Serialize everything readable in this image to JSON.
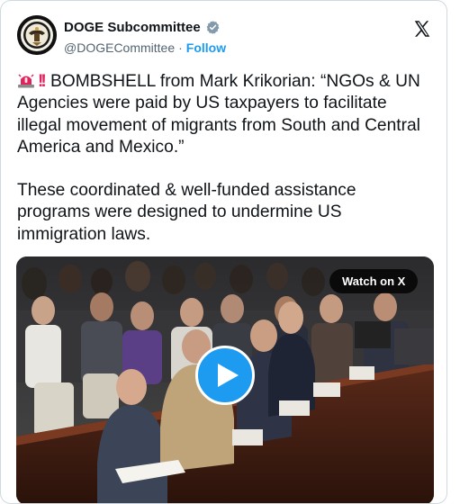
{
  "author": {
    "display_name": "DOGE Subcommittee",
    "handle": "@DOGECommittee",
    "separator": "·",
    "follow_label": "Follow",
    "verified_badge_color": "#829aab"
  },
  "tweet": {
    "emoji_prefix": [
      "siren-emoji",
      "double-exclamation-emoji"
    ],
    "paragraph1": "BOMBSHELL from Mark Krikorian: “NGOs & UN Agencies were paid by US taxpayers to facilitate illegal movement of migrants from South and Central America and Mexico.”",
    "paragraph2": "These coordinated & well-funded assistance programs were designed to undermine US immigration laws."
  },
  "media": {
    "watch_label": "Watch on X",
    "play_icon": "play-icon"
  },
  "colors": {
    "accent": "#1d9bf0",
    "text": "#0f1419",
    "muted": "#536471",
    "border": "#cfd9de"
  }
}
